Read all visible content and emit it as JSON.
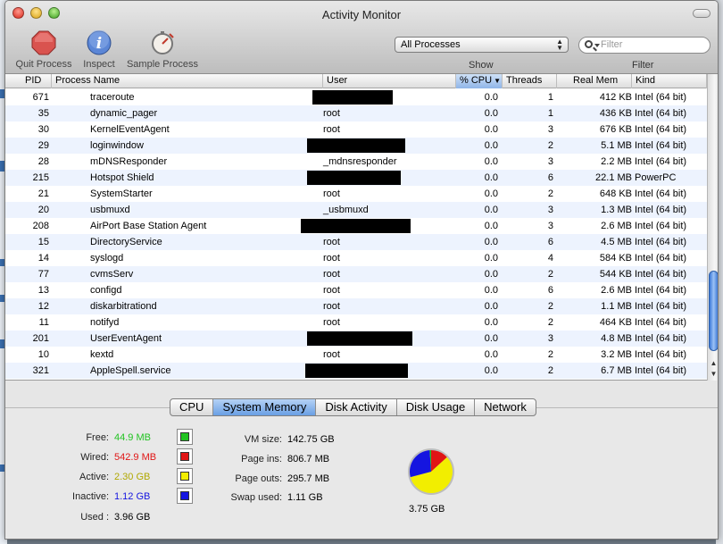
{
  "window": {
    "title": "Activity Monitor"
  },
  "toolbar": {
    "quit_label": "Quit Process",
    "inspect_label": "Inspect",
    "sample_label": "Sample Process",
    "show_label": "Show",
    "filter_label": "Filter",
    "process_filter": "All Processes",
    "search_placeholder": "Filter"
  },
  "columns": {
    "pid": "PID",
    "name": "Process Name",
    "user": "User",
    "cpu": "% CPU",
    "threads": "Threads",
    "mem": "Real Mem",
    "kind": "Kind"
  },
  "processes": [
    {
      "pid": "671",
      "name": "traceroute",
      "user": "",
      "cpu": "0.0",
      "threads": "1",
      "mem": "412 KB",
      "kind": "Intel (64 bit)"
    },
    {
      "pid": "35",
      "name": "dynamic_pager",
      "user": "root",
      "cpu": "0.0",
      "threads": "1",
      "mem": "436 KB",
      "kind": "Intel (64 bit)"
    },
    {
      "pid": "30",
      "name": "KernelEventAgent",
      "user": "root",
      "cpu": "0.0",
      "threads": "3",
      "mem": "676 KB",
      "kind": "Intel (64 bit)"
    },
    {
      "pid": "29",
      "name": "loginwindow",
      "user": "",
      "cpu": "0.0",
      "threads": "2",
      "mem": "5.1 MB",
      "kind": "Intel (64 bit)"
    },
    {
      "pid": "28",
      "name": "mDNSResponder",
      "user": "_mdnsresponder",
      "cpu": "0.0",
      "threads": "3",
      "mem": "2.2 MB",
      "kind": "Intel (64 bit)"
    },
    {
      "pid": "215",
      "name": "Hotspot Shield",
      "user": "",
      "cpu": "0.0",
      "threads": "6",
      "mem": "22.1 MB",
      "kind": "PowerPC"
    },
    {
      "pid": "21",
      "name": "SystemStarter",
      "user": "root",
      "cpu": "0.0",
      "threads": "2",
      "mem": "648 KB",
      "kind": "Intel (64 bit)"
    },
    {
      "pid": "20",
      "name": "usbmuxd",
      "user": "_usbmuxd",
      "cpu": "0.0",
      "threads": "3",
      "mem": "1.3 MB",
      "kind": "Intel (64 bit)"
    },
    {
      "pid": "208",
      "name": "AirPort Base Station Agent",
      "user": "",
      "cpu": "0.0",
      "threads": "3",
      "mem": "2.6 MB",
      "kind": "Intel (64 bit)"
    },
    {
      "pid": "15",
      "name": "DirectoryService",
      "user": "root",
      "cpu": "0.0",
      "threads": "6",
      "mem": "4.5 MB",
      "kind": "Intel (64 bit)"
    },
    {
      "pid": "14",
      "name": "syslogd",
      "user": "root",
      "cpu": "0.0",
      "threads": "4",
      "mem": "584 KB",
      "kind": "Intel (64 bit)"
    },
    {
      "pid": "77",
      "name": "cvmsServ",
      "user": "root",
      "cpu": "0.0",
      "threads": "2",
      "mem": "544 KB",
      "kind": "Intel (64 bit)"
    },
    {
      "pid": "13",
      "name": "configd",
      "user": "root",
      "cpu": "0.0",
      "threads": "6",
      "mem": "2.6 MB",
      "kind": "Intel (64 bit)"
    },
    {
      "pid": "12",
      "name": "diskarbitrationd",
      "user": "root",
      "cpu": "0.0",
      "threads": "2",
      "mem": "1.1 MB",
      "kind": "Intel (64 bit)"
    },
    {
      "pid": "11",
      "name": "notifyd",
      "user": "root",
      "cpu": "0.0",
      "threads": "2",
      "mem": "464 KB",
      "kind": "Intel (64 bit)"
    },
    {
      "pid": "201",
      "name": "UserEventAgent",
      "user": "",
      "cpu": "0.0",
      "threads": "3",
      "mem": "4.8 MB",
      "kind": "Intel (64 bit)"
    },
    {
      "pid": "10",
      "name": "kextd",
      "user": "root",
      "cpu": "0.0",
      "threads": "2",
      "mem": "3.2 MB",
      "kind": "Intel (64 bit)"
    },
    {
      "pid": "321",
      "name": "AppleSpell.service",
      "user": "",
      "cpu": "0.0",
      "threads": "2",
      "mem": "6.7 MB",
      "kind": "Intel (64 bit)"
    }
  ],
  "tabs": [
    "CPU",
    "System Memory",
    "Disk Activity",
    "Disk Usage",
    "Network"
  ],
  "active_tab": "System Memory",
  "memory": {
    "free_label": "Free:",
    "free": "44.9 MB",
    "free_color": "#22c322",
    "wired_label": "Wired:",
    "wired": "542.9 MB",
    "wired_color": "#e01515",
    "active_label": "Active:",
    "active": "2.30 GB",
    "active_color": "#f2ee00",
    "inactive_label": "Inactive:",
    "inactive": "1.12 GB",
    "inactive_color": "#1515e0",
    "used_label": "Used :",
    "used": "3.96 GB",
    "vmsize_label": "VM size:",
    "vmsize": "142.75 GB",
    "pageins_label": "Page ins:",
    "pageins": "806.7 MB",
    "pageouts_label": "Page outs:",
    "pageouts": "295.7 MB",
    "swap_label": "Swap used:",
    "swap": "1.11 GB",
    "total": "3.75 GB"
  }
}
